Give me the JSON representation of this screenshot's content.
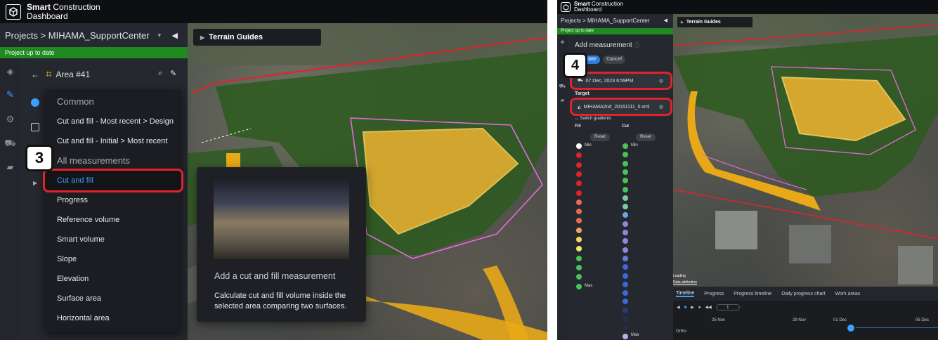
{
  "app": {
    "brand_line1": "Smart",
    "brand_line1b": "Construction",
    "brand_line2": "Dashboard"
  },
  "left": {
    "breadcrumb": "Projects > MIHAMA_SupportCenter",
    "status": "Project up to date",
    "area_title": "Area #41",
    "terrain_guides": "Terrain Guides",
    "menu": {
      "section_common": "Common",
      "common_items": [
        "Cut and fill - Most recent > Design",
        "Cut and fill - Initial > Most recent"
      ],
      "section_all": "All measurements",
      "items": [
        "Cut and fill",
        "Progress",
        "Reference volume",
        "Smart volume",
        "Slope",
        "Elevation",
        "Surface area",
        "Horizontal area"
      ]
    },
    "step_badge": "3",
    "tooltip": {
      "title": "Add a cut and fill measurement",
      "body": "Calculate cut and fill volume inside the selected area comparing two surfaces."
    }
  },
  "right": {
    "breadcrumb": "Projects > MIHAMA_SupportCenter",
    "status": "Project up to date",
    "terrain_guides": "Terrain Guides",
    "panel_title": "Add measurement",
    "update_btn": "date",
    "cancel_btn": "Cancel",
    "step_badge": "4",
    "reference_value": "07 Dec, 2023 6:59PM",
    "target_label": "Target",
    "target_value": "MIHAMA2nd_20161111_0.xml",
    "switch_gradients": "Switch gradients",
    "fill_label": "Fill",
    "cut_label": "Cut",
    "reset": "Reset",
    "min": "Min",
    "max": "Max",
    "loading": "Loading",
    "data_attribution": "Data attribution",
    "tabs": [
      "Timeline",
      "Progress",
      "Progress timeline",
      "Daily progress chart",
      "Work areas"
    ],
    "page_value": "1",
    "timeline_dates": [
      "25 Nov",
      "29 Nov",
      "01 Dec",
      "05 Dec"
    ],
    "ortho_label": "Ortho",
    "fill_colors": [
      "#ffffff",
      "#e0232b",
      "#e0232b",
      "#e0232b",
      "#e0232b",
      "#e0232b",
      "#ea6a52",
      "#ea6a52",
      "#ea6a52",
      "#f0a36a",
      "#f2d95c",
      "#f2e86a",
      "#4ac25a",
      "#4ac25a",
      "#4ac25a",
      "#4ac25a"
    ],
    "cut_colors": [
      "#4ac25a",
      "#4ac25a",
      "#4ac25a",
      "#4ac25a",
      "#4ac25a",
      "#4ac25a",
      "#7cc8a0",
      "#7cc8a0",
      "#6aa8d8",
      "#8a8ad8",
      "#8a8ad8",
      "#8a8ad8",
      "#8a8ad8",
      "#6a7ad8",
      "#3a6ad8",
      "#3a6ad8",
      "#3a6ad8",
      "#3a6ad8",
      "#3a6ad8",
      "#2a3a70",
      "#2a2a40",
      "#2a2a40",
      "#c9a6e8"
    ]
  }
}
